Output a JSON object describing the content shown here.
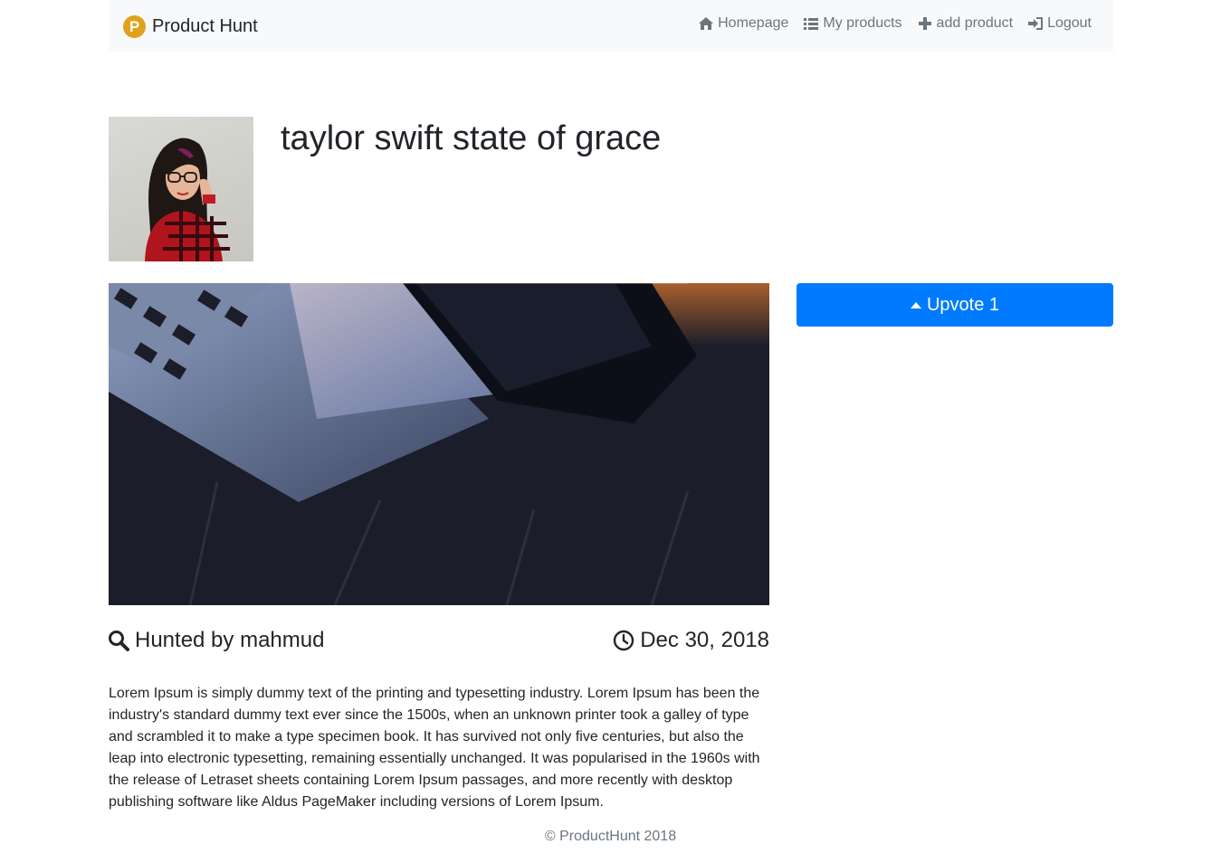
{
  "navbar": {
    "brand_letter": "P",
    "brand_name": "Product Hunt",
    "items": [
      {
        "label": "Homepage",
        "icon": "home-icon"
      },
      {
        "label": "My products",
        "icon": "list-icon"
      },
      {
        "label": "add product",
        "icon": "plus-icon"
      },
      {
        "label": "Logout",
        "icon": "sign-out-icon"
      }
    ]
  },
  "product": {
    "title": "taylor swift state of grace",
    "upvote_label": "Upvote",
    "upvote_count": "1",
    "hunted_by": "Hunted by mahmud",
    "date": "Dec 30, 2018",
    "description": "Lorem Ipsum is simply dummy text of the printing and typesetting industry. Lorem Ipsum has been the industry's standard dummy text ever since the 1500s, when an unknown printer took a galley of type and scrambled it to make a type specimen book. It has survived not only five centuries, but also the leap into electronic typesetting, remaining essentially unchanged. It was popularised in the 1960s with the release of Letraset sheets containing Lorem Ipsum passages, and more recently with desktop publishing software like Aldus PageMaker including versions of Lorem Ipsum."
  },
  "footer": {
    "text": "© ProductHunt 2018"
  },
  "colors": {
    "primary": "#007bff",
    "brand": "#e0a21c",
    "navbar_bg": "#f8f9fa",
    "muted": "#6c757d"
  }
}
